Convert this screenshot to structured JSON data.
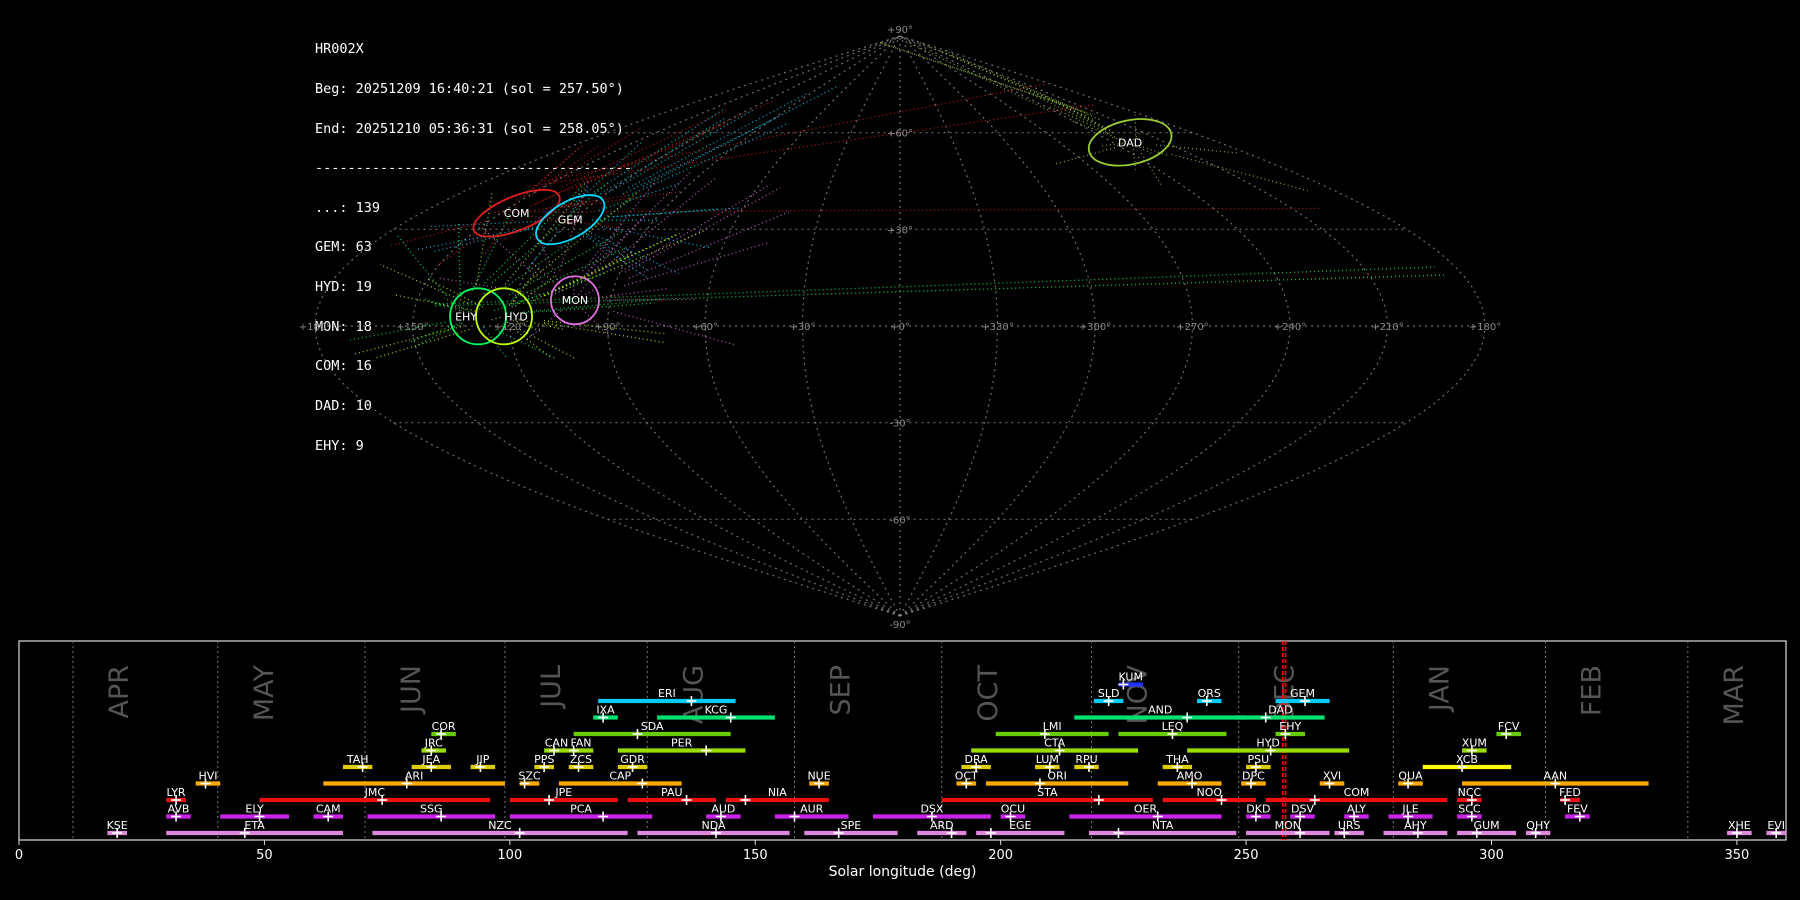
{
  "info": {
    "station": "HR002X",
    "begin": "Beg: 20251209 16:40:21 (sol = 257.50°)",
    "end": "End: 20251210 05:36:31 (sol = 258.05°)",
    "separator": "---------------------------------------",
    "counts": [
      "...: 139",
      "GEM: 63",
      "HYD: 19",
      "MON: 18",
      "COM: 16",
      "DAD: 10",
      "EHY: 9"
    ]
  },
  "colors": {
    "background": "#000000",
    "grid": "#888888",
    "marker": "#ff0000",
    "month_label": "#555555"
  },
  "chart_data": [
    {
      "type": "scatter",
      "projection": "sinusoidal",
      "lon_ticks": [
        "+180°",
        "+150°",
        "+120°",
        "+90°",
        "+60°",
        "+30°",
        "+0°",
        "+330°",
        "+300°",
        "+270°",
        "+240°",
        "+210°",
        "+180°"
      ],
      "lat_ticks": [
        "+90°",
        "+60°",
        "+30°",
        "-30°",
        "-60°",
        "-90°"
      ],
      "radiants": [
        {
          "name": "DAD",
          "lon": 230,
          "lat": 57,
          "color": "#9acd32"
        },
        {
          "name": "COM",
          "lon": 144,
          "lat": 35,
          "color": "#e02020"
        },
        {
          "name": "GEM",
          "lon": 121,
          "lat": 33,
          "color": "#00d8ff"
        },
        {
          "name": "MON",
          "lon": 101,
          "lat": 8,
          "color": "#e070e0"
        },
        {
          "name": "EHY",
          "lon": 130,
          "lat": 3,
          "color": "#00ff60"
        },
        {
          "name": "HYD",
          "lon": 122,
          "lat": 3,
          "color": "#c0ff00"
        }
      ],
      "grid": true
    },
    {
      "type": "bar",
      "xlabel": "Solar longitude (deg)",
      "xlim": [
        0,
        360
      ],
      "xticks": [
        0,
        50,
        100,
        150,
        200,
        250,
        300,
        350
      ],
      "months": [
        {
          "name": "APR",
          "start": 11
        },
        {
          "name": "MAY",
          "start": 40.5
        },
        {
          "name": "JUN",
          "start": 70.5
        },
        {
          "name": "JUL",
          "start": 99
        },
        {
          "name": "AUG",
          "start": 128
        },
        {
          "name": "SEP",
          "start": 158
        },
        {
          "name": "OCT",
          "start": 188
        },
        {
          "name": "NOV",
          "start": 218.5
        },
        {
          "name": "DEC",
          "start": 248.5
        },
        {
          "name": "JAN",
          "start": 280
        },
        {
          "name": "FEB",
          "start": 311
        },
        {
          "name": "MAR",
          "start": 340
        }
      ],
      "current_sol": [
        257.5,
        258.05
      ],
      "showers": [
        {
          "name": "KUM",
          "start": 224,
          "end": 229,
          "peak": 225,
          "row": 9,
          "color": "#2233ff"
        },
        {
          "name": "ERI",
          "start": 118,
          "end": 146,
          "peak": 137,
          "row": 8,
          "color": "#00ccff"
        },
        {
          "name": "SLD",
          "start": 219,
          "end": 225,
          "peak": 222,
          "row": 8,
          "color": "#00ccff"
        },
        {
          "name": "ORS",
          "start": 240,
          "end": 245,
          "peak": 242,
          "row": 8,
          "color": "#00ccff"
        },
        {
          "name": "GEM",
          "start": 256,
          "end": 267,
          "peak": 262,
          "row": 8,
          "color": "#00ccff"
        },
        {
          "name": "IXA",
          "start": 117,
          "end": 122,
          "peak": 119,
          "row": 7,
          "color": "#00e070"
        },
        {
          "name": "KCG",
          "start": 130,
          "end": 154,
          "peak": 145,
          "row": 7,
          "color": "#00e070"
        },
        {
          "name": "AND",
          "start": 215,
          "end": 250,
          "peak": 238,
          "row": 7,
          "color": "#00e070"
        },
        {
          "name": "DAD",
          "start": 248,
          "end": 266,
          "peak": 254,
          "row": 7,
          "color": "#00e070"
        },
        {
          "name": "COR",
          "start": 84,
          "end": 89,
          "peak": 86,
          "row": 6,
          "color": "#66cc00"
        },
        {
          "name": "SDA",
          "start": 113,
          "end": 145,
          "peak": 126,
          "row": 6,
          "color": "#66cc00"
        },
        {
          "name": "LMI",
          "start": 199,
          "end": 222,
          "peak": 209,
          "row": 6,
          "color": "#66cc00"
        },
        {
          "name": "LEQ",
          "start": 224,
          "end": 246,
          "peak": 235,
          "row": 6,
          "color": "#66cc00"
        },
        {
          "name": "EHY",
          "start": 256,
          "end": 262,
          "peak": 258,
          "row": 6,
          "color": "#66cc00"
        },
        {
          "name": "FCV",
          "start": 301,
          "end": 306,
          "peak": 303,
          "row": 6,
          "color": "#66cc00"
        },
        {
          "name": "JRC",
          "start": 82,
          "end": 87,
          "peak": 84,
          "row": 5,
          "color": "#99dd00"
        },
        {
          "name": "CAN",
          "start": 107,
          "end": 112,
          "peak": 109,
          "row": 5,
          "color": "#99dd00"
        },
        {
          "name": "FAN",
          "start": 112,
          "end": 117,
          "peak": 113,
          "row": 5,
          "color": "#99dd00"
        },
        {
          "name": "PER",
          "start": 122,
          "end": 148,
          "peak": 140,
          "row": 5,
          "color": "#99dd00"
        },
        {
          "name": "CTA",
          "start": 194,
          "end": 228,
          "peak": 212,
          "row": 5,
          "color": "#99dd00"
        },
        {
          "name": "HYD",
          "start": 238,
          "end": 271,
          "peak": 255,
          "row": 5,
          "color": "#99dd00"
        },
        {
          "name": "XUM",
          "start": 294,
          "end": 299,
          "peak": 296,
          "row": 5,
          "color": "#99dd00"
        },
        {
          "name": "TAH",
          "start": 66,
          "end": 72,
          "peak": 70,
          "row": 4,
          "color": "#ddcc00"
        },
        {
          "name": "JEA",
          "start": 80,
          "end": 88,
          "peak": 84,
          "row": 4,
          "color": "#ddcc00"
        },
        {
          "name": "JIP",
          "start": 92,
          "end": 97,
          "peak": 94,
          "row": 4,
          "color": "#ddcc00"
        },
        {
          "name": "PPS",
          "start": 105,
          "end": 109,
          "peak": 107,
          "row": 4,
          "color": "#ddcc00"
        },
        {
          "name": "ZCS",
          "start": 112,
          "end": 117,
          "peak": 114,
          "row": 4,
          "color": "#ddcc00"
        },
        {
          "name": "GDR",
          "start": 122,
          "end": 128,
          "peak": 125,
          "row": 4,
          "color": "#ddcc00"
        },
        {
          "name": "DRA",
          "start": 192,
          "end": 198,
          "peak": 195,
          "row": 4,
          "color": "#ddcc00"
        },
        {
          "name": "LUM",
          "start": 207,
          "end": 212,
          "peak": 210,
          "row": 4,
          "color": "#ddcc00"
        },
        {
          "name": "RPU",
          "start": 215,
          "end": 220,
          "peak": 218,
          "row": 4,
          "color": "#ddcc00"
        },
        {
          "name": "THA",
          "start": 233,
          "end": 239,
          "peak": 236,
          "row": 4,
          "color": "#ddcc00"
        },
        {
          "name": "PSU",
          "start": 250,
          "end": 255,
          "peak": 252,
          "row": 4,
          "color": "#ddcc00"
        },
        {
          "name": "XCB",
          "start": 286,
          "end": 304,
          "peak": 294,
          "row": 4,
          "color": "#ffff00"
        },
        {
          "name": "HVI",
          "start": 36,
          "end": 41,
          "peak": 38,
          "row": 3,
          "color": "#ffaa00"
        },
        {
          "name": "ARI",
          "start": 62,
          "end": 99,
          "peak": 79,
          "row": 3,
          "color": "#ffaa00"
        },
        {
          "name": "SZC",
          "start": 102,
          "end": 106,
          "peak": 103,
          "row": 3,
          "color": "#ffaa00"
        },
        {
          "name": "CAP",
          "start": 110,
          "end": 135,
          "peak": 127,
          "row": 3,
          "color": "#ffaa00"
        },
        {
          "name": "NUE",
          "start": 161,
          "end": 165,
          "peak": 163,
          "row": 3,
          "color": "#ffaa00"
        },
        {
          "name": "OCT",
          "start": 191,
          "end": 195,
          "peak": 193,
          "row": 3,
          "color": "#ffaa00"
        },
        {
          "name": "ORI",
          "start": 197,
          "end": 226,
          "peak": 208,
          "row": 3,
          "color": "#ffaa00"
        },
        {
          "name": "AMO",
          "start": 232,
          "end": 245,
          "peak": 239,
          "row": 3,
          "color": "#ffaa00"
        },
        {
          "name": "DPC",
          "start": 249,
          "end": 254,
          "peak": 251,
          "row": 3,
          "color": "#ffaa00"
        },
        {
          "name": "XVI",
          "start": 265,
          "end": 270,
          "peak": 267,
          "row": 3,
          "color": "#ffaa00"
        },
        {
          "name": "QUA",
          "start": 281,
          "end": 286,
          "peak": 283,
          "row": 3,
          "color": "#ffaa00"
        },
        {
          "name": "AAN",
          "start": 294,
          "end": 332,
          "peak": 313,
          "row": 3,
          "color": "#ffaa00"
        },
        {
          "name": "LYR",
          "start": 30,
          "end": 34,
          "peak": 32,
          "row": 2,
          "color": "#ee1111"
        },
        {
          "name": "JMC",
          "start": 49,
          "end": 96,
          "peak": 74,
          "row": 2,
          "color": "#ee1111"
        },
        {
          "name": "JPE",
          "start": 100,
          "end": 122,
          "peak": 108,
          "row": 2,
          "color": "#ee1111"
        },
        {
          "name": "PAU",
          "start": 124,
          "end": 142,
          "peak": 136,
          "row": 2,
          "color": "#ee1111"
        },
        {
          "name": "NIA",
          "start": 144,
          "end": 165,
          "peak": 148,
          "row": 2,
          "color": "#ee1111"
        },
        {
          "name": "STA",
          "start": 188,
          "end": 231,
          "peak": 220,
          "row": 2,
          "color": "#ee1111"
        },
        {
          "name": "NOO",
          "start": 233,
          "end": 252,
          "peak": 245,
          "row": 2,
          "color": "#ee1111"
        },
        {
          "name": "COM",
          "start": 254,
          "end": 291,
          "peak": 264,
          "row": 2,
          "color": "#ee1111"
        },
        {
          "name": "NCC",
          "start": 293,
          "end": 298,
          "peak": 296,
          "row": 2,
          "color": "#ee1111"
        },
        {
          "name": "FED",
          "start": 314,
          "end": 318,
          "peak": 315,
          "row": 2,
          "color": "#ee1111"
        },
        {
          "name": "AVB",
          "start": 30,
          "end": 35,
          "peak": 32,
          "row": 1,
          "color": "#cc22ee"
        },
        {
          "name": "ELY",
          "start": 41,
          "end": 55,
          "peak": 49,
          "row": 1,
          "color": "#cc22ee"
        },
        {
          "name": "CAM",
          "start": 60,
          "end": 66,
          "peak": 63,
          "row": 1,
          "color": "#cc22ee"
        },
        {
          "name": "SSG",
          "start": 71,
          "end": 97,
          "peak": 86,
          "row": 1,
          "color": "#cc22ee"
        },
        {
          "name": "PCA",
          "start": 100,
          "end": 129,
          "peak": 119,
          "row": 1,
          "color": "#cc22ee"
        },
        {
          "name": "AUD",
          "start": 140,
          "end": 147,
          "peak": 143,
          "row": 1,
          "color": "#cc22ee"
        },
        {
          "name": "AUR",
          "start": 154,
          "end": 169,
          "peak": 158,
          "row": 1,
          "color": "#cc22ee"
        },
        {
          "name": "DSX",
          "start": 174,
          "end": 198,
          "peak": 186,
          "row": 1,
          "color": "#cc22ee"
        },
        {
          "name": "OCU",
          "start": 200,
          "end": 205,
          "peak": 202,
          "row": 1,
          "color": "#cc22ee"
        },
        {
          "name": "OER",
          "start": 214,
          "end": 245,
          "peak": 232,
          "row": 1,
          "color": "#cc22ee"
        },
        {
          "name": "DKD",
          "start": 250,
          "end": 255,
          "peak": 252,
          "row": 1,
          "color": "#cc22ee"
        },
        {
          "name": "DSV",
          "start": 259,
          "end": 264,
          "peak": 261,
          "row": 1,
          "color": "#cc22ee"
        },
        {
          "name": "ALY",
          "start": 270,
          "end": 275,
          "peak": 272,
          "row": 1,
          "color": "#cc22ee"
        },
        {
          "name": "JLE",
          "start": 279,
          "end": 288,
          "peak": 283,
          "row": 1,
          "color": "#cc22ee"
        },
        {
          "name": "SCC",
          "start": 293,
          "end": 298,
          "peak": 296,
          "row": 1,
          "color": "#cc22ee"
        },
        {
          "name": "FEV",
          "start": 315,
          "end": 320,
          "peak": 318,
          "row": 1,
          "color": "#cc22ee"
        },
        {
          "name": "KSE",
          "start": 18,
          "end": 22,
          "peak": 20,
          "row": 0,
          "color": "#dd88dd"
        },
        {
          "name": "ETA",
          "start": 30,
          "end": 66,
          "peak": 46,
          "row": 0,
          "color": "#dd88dd"
        },
        {
          "name": "NZC",
          "start": 72,
          "end": 124,
          "peak": 102,
          "row": 0,
          "color": "#dd88dd"
        },
        {
          "name": "NDA",
          "start": 126,
          "end": 157,
          "peak": 142,
          "row": 0,
          "color": "#dd88dd"
        },
        {
          "name": "SPE",
          "start": 160,
          "end": 179,
          "peak": 167,
          "row": 0,
          "color": "#dd88dd"
        },
        {
          "name": "ARD",
          "start": 183,
          "end": 193,
          "peak": 190,
          "row": 0,
          "color": "#dd88dd"
        },
        {
          "name": "EGE",
          "start": 195,
          "end": 213,
          "peak": 198,
          "row": 0,
          "color": "#dd88dd"
        },
        {
          "name": "NTA",
          "start": 218,
          "end": 248,
          "peak": 224,
          "row": 0,
          "color": "#dd88dd"
        },
        {
          "name": "MON",
          "start": 250,
          "end": 267,
          "peak": 261,
          "row": 0,
          "color": "#dd88dd"
        },
        {
          "name": "URS",
          "start": 268,
          "end": 274,
          "peak": 270,
          "row": 0,
          "color": "#dd88dd"
        },
        {
          "name": "AHY",
          "start": 278,
          "end": 291,
          "peak": 285,
          "row": 0,
          "color": "#dd88dd"
        },
        {
          "name": "GUM",
          "start": 293,
          "end": 305,
          "peak": 297,
          "row": 0,
          "color": "#dd88dd"
        },
        {
          "name": "QHY",
          "start": 307,
          "end": 312,
          "peak": 309,
          "row": 0,
          "color": "#dd88dd"
        },
        {
          "name": "XHE",
          "start": 348,
          "end": 353,
          "peak": 350,
          "row": 0,
          "color": "#dd88dd"
        },
        {
          "name": "EVI",
          "start": 356,
          "end": 360,
          "peak": 358,
          "row": 0,
          "color": "#dd88dd"
        }
      ]
    }
  ]
}
